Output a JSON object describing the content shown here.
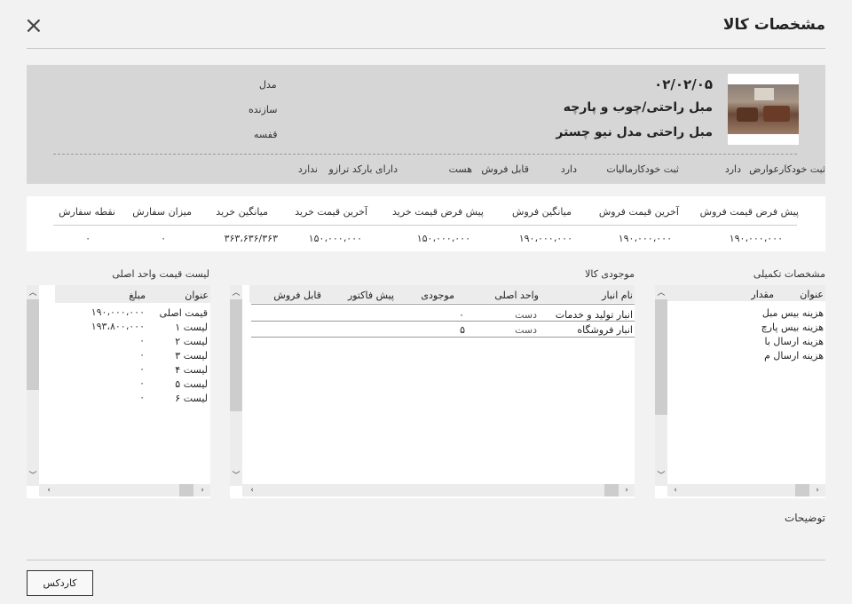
{
  "window": {
    "title": "مشخصات کالا",
    "close_icon": "×"
  },
  "product": {
    "code": "۰۲/۰۲/۰۵",
    "category": "مبل راحتی/چوب و پارچه",
    "name": "مبل راحتی مدل نیو چستر",
    "labels": {
      "model": "مدل",
      "maker": "سازنده",
      "shelf": "قفسه"
    }
  },
  "flags": {
    "auto_tax_label": "ثبت خودکارعوارض",
    "auto_tax_value": "دارد",
    "auto_vat_label": "ثبت خودکارمالیات",
    "auto_vat_value": "دارد",
    "sellable_label": "قابل فروش",
    "sellable_value": "هست",
    "scale_barcode_label": "دارای بارکد ترازو",
    "scale_barcode_value": "ندارد"
  },
  "prices": {
    "headers": [
      "پیش فرض قیمت فروش",
      "آخرین قیمت فروش",
      "میانگین فروش",
      "پیش فرض قیمت خرید",
      "آخرین قیمت خرید",
      "میانگین خرید",
      "میزان سفارش",
      "نقطه سفارش"
    ],
    "values": [
      "۱۹۰،۰۰۰،۰۰۰",
      "۱۹۰،۰۰۰،۰۰۰",
      "۱۹۰،۰۰۰،۰۰۰",
      "۱۵۰،۰۰۰،۰۰۰",
      "۱۵۰،۰۰۰،۰۰۰",
      "۳۶۳،۶۳۶/۳۶۳",
      "۰",
      "۰"
    ]
  },
  "extra_specs": {
    "title": "مشخصات تکمیلی",
    "col_title": "عنوان",
    "col_amount": "مقدار",
    "rows": [
      "هزینه بیس مبل",
      "هزینه بیس پارچ",
      "هزینه ارسال با",
      "هزینه ارسال م"
    ]
  },
  "stock": {
    "title": "موجودی کالا",
    "cols": {
      "warehouse": "نام انبار",
      "unit": "واحد اصلی",
      "qty": "موجودی",
      "preinvoice": "پیش فاکتور",
      "sellable": "قابل فروش"
    },
    "rows": [
      {
        "warehouse": "انبار تولید و خدمات",
        "unit": "دست",
        "qty": "۰"
      },
      {
        "warehouse": "انبار فروشگاه",
        "unit": "دست",
        "qty": "۵"
      }
    ]
  },
  "price_list": {
    "title": "لیست قیمت واحد اصلی",
    "col_title": "عنوان",
    "col_amount": "مبلغ",
    "rows": [
      {
        "title": "قیمت اصلی",
        "amount": "۱۹۰،۰۰۰،۰۰۰"
      },
      {
        "title": "لیست ۱",
        "amount": "۱۹۳،۸۰۰،۰۰۰"
      },
      {
        "title": "لیست ۲",
        "amount": "۰"
      },
      {
        "title": "لیست ۳",
        "amount": "۰"
      },
      {
        "title": "لیست ۴",
        "amount": "۰"
      },
      {
        "title": "لیست ۵",
        "amount": "۰"
      },
      {
        "title": "لیست ۶",
        "amount": "۰"
      }
    ]
  },
  "notes_label": "توضیحات",
  "kardex_button": "کاردکس",
  "icons": {
    "up": "chevron-up-icon",
    "down": "chevron-down-icon",
    "left": "chevron-left-icon",
    "right": "chevron-right-icon"
  }
}
